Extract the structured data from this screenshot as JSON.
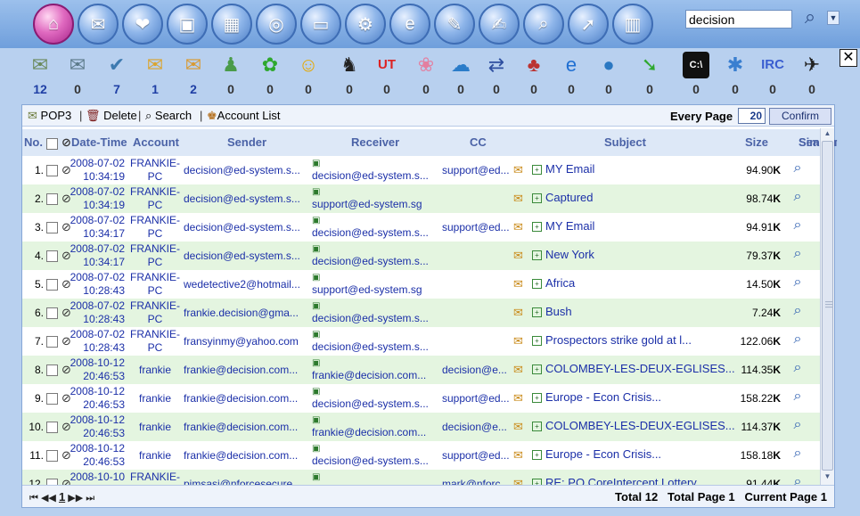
{
  "search": {
    "value": "decision"
  },
  "modules": [
    {
      "icon": "computer-icon",
      "glyph": "⌂"
    },
    {
      "icon": "envelope-icon",
      "glyph": "✉"
    },
    {
      "icon": "lips-icon",
      "glyph": "❤"
    },
    {
      "icon": "window-icon",
      "glyph": "▣"
    },
    {
      "icon": "box-icon",
      "glyph": "▦"
    },
    {
      "icon": "globe-icon",
      "glyph": "◎"
    },
    {
      "icon": "terminal-icon",
      "glyph": "▭"
    },
    {
      "icon": "gear-icon",
      "glyph": "⚙"
    },
    {
      "icon": "browser-icon",
      "glyph": "e"
    },
    {
      "icon": "tools-icon",
      "glyph": "✎"
    },
    {
      "icon": "notepad-icon",
      "glyph": "✍"
    },
    {
      "icon": "magnifier-icon",
      "glyph": "⌕"
    },
    {
      "icon": "mail-send-icon",
      "glyph": "➚"
    },
    {
      "icon": "chart-icon",
      "glyph": "▥"
    }
  ],
  "sources": [
    {
      "icon": "pop3-inbox-icon",
      "glyph": "✉",
      "count": "12",
      "color": "#6b8a5c"
    },
    {
      "icon": "download-mail-icon",
      "glyph": "✉",
      "count": "0",
      "color": "#5c7a8a"
    },
    {
      "icon": "outlook-icon",
      "glyph": "✔",
      "count": "7",
      "color": "#3d7ab0"
    },
    {
      "icon": "envelope-icon",
      "glyph": "✉",
      "count": "1",
      "color": "#d9a532"
    },
    {
      "icon": "webmail-icon",
      "glyph": "✉",
      "count": "2",
      "color": "#d99a32"
    },
    {
      "icon": "msn-icon",
      "glyph": "♟",
      "count": "0",
      "color": "#4a9b4a"
    },
    {
      "icon": "icq-icon",
      "glyph": "✿",
      "count": "0",
      "color": "#2ea82e"
    },
    {
      "icon": "yahoo-icon",
      "glyph": "☺",
      "count": "0",
      "color": "#e6a800"
    },
    {
      "icon": "qq-icon",
      "glyph": "♞",
      "count": "0",
      "color": "#222"
    },
    {
      "icon": "ut-icon",
      "glyph": "UT",
      "count": "0",
      "color": "#d22"
    },
    {
      "icon": "skype-icon",
      "glyph": "❀",
      "count": "0",
      "color": "#e37fa0"
    },
    {
      "icon": "file-transfer-icon",
      "glyph": "☁",
      "count": "0",
      "color": "#2b7cc9"
    },
    {
      "icon": "network-icon",
      "glyph": "⇄",
      "count": "0",
      "color": "#2e4fa0"
    },
    {
      "icon": "chat-icon",
      "glyph": "♣",
      "count": "0",
      "color": "#b33"
    },
    {
      "icon": "ie-icon",
      "glyph": "e",
      "count": "0",
      "color": "#1f6fd2"
    },
    {
      "icon": "earth-icon",
      "glyph": "●",
      "count": "0",
      "color": "#2b78c2"
    },
    {
      "icon": "arrow-icon",
      "glyph": "➘",
      "count": "0",
      "color": "#2ea82e"
    },
    {
      "icon": "cmd-icon",
      "glyph": "C:\\",
      "count": "0",
      "color": "#111"
    },
    {
      "icon": "settings-icon",
      "glyph": "✱",
      "count": "0",
      "color": "#3a7fd0"
    },
    {
      "icon": "irc-icon",
      "glyph": "IRC",
      "count": "0",
      "color": "#3a5ed0"
    },
    {
      "icon": "camera-icon",
      "glyph": "✈",
      "count": "0",
      "color": "#222"
    }
  ],
  "toolbar": {
    "pop3": "POP3",
    "delete": "Delete",
    "search": "Search",
    "account_list": "Account List",
    "every_page_label": "Every Page",
    "every_page_value": "20",
    "confirm": "Confirm"
  },
  "columns": {
    "no": "No.",
    "datetime": "Date-Time",
    "account": "Account",
    "sender": "Sender",
    "receiver": "Receiver",
    "cc": "CC",
    "subject": "Subject",
    "size": "Size",
    "similar_1": "Similar",
    "similar_2": "Search"
  },
  "rows": [
    {
      "no": "1.",
      "date": "2008-07-02",
      "time": "10:34:19",
      "account": "FRANKIE-PC",
      "sender": "decision@ed-system.s...",
      "receiver": "decision@ed-system.s...",
      "cc": "support@ed...",
      "subject": "MY Email",
      "size": "94.90",
      "unit": "K"
    },
    {
      "no": "2.",
      "date": "2008-07-02",
      "time": "10:34:19",
      "account": "FRANKIE-PC",
      "sender": "decision@ed-system.s...",
      "receiver": "support@ed-system.sg",
      "cc": "",
      "subject": "Captured",
      "size": "98.74",
      "unit": "K"
    },
    {
      "no": "3.",
      "date": "2008-07-02",
      "time": "10:34:17",
      "account": "FRANKIE-PC",
      "sender": "decision@ed-system.s...",
      "receiver": "decision@ed-system.s...",
      "cc": "support@ed...",
      "subject": "MY Email",
      "size": "94.91",
      "unit": "K"
    },
    {
      "no": "4.",
      "date": "2008-07-02",
      "time": "10:34:17",
      "account": "FRANKIE-PC",
      "sender": "decision@ed-system.s...",
      "receiver": "decision@ed-system.s...",
      "cc": "",
      "subject": "New York",
      "size": "79.37",
      "unit": "K"
    },
    {
      "no": "5.",
      "date": "2008-07-02",
      "time": "10:28:43",
      "account": "FRANKIE-PC",
      "sender": "wedetective2@hotmail...",
      "receiver": "support@ed-system.sg",
      "cc": "",
      "subject": "Africa",
      "size": "14.50",
      "unit": "K"
    },
    {
      "no": "6.",
      "date": "2008-07-02",
      "time": "10:28:43",
      "account": "FRANKIE-PC",
      "sender": "frankie.decision@gma...",
      "receiver": "decision@ed-system.s...",
      "cc": "",
      "subject": "Bush",
      "size": "7.24",
      "unit": "K"
    },
    {
      "no": "7.",
      "date": "2008-07-02",
      "time": "10:28:43",
      "account": "FRANKIE-PC",
      "sender": "fransyinmy@yahoo.com",
      "receiver": "decision@ed-system.s...",
      "cc": "",
      "subject": "Prospectors strike gold at l...",
      "size": "122.06",
      "unit": "K"
    },
    {
      "no": "8.",
      "date": "2008-10-12",
      "time": "20:46:53",
      "account": "frankie",
      "sender": "frankie@decision.com...",
      "receiver": "frankie@decision.com...",
      "cc": "decision@e...",
      "subject": "COLOMBEY-LES-DEUX-EGLISES...",
      "size": "114.35",
      "unit": "K"
    },
    {
      "no": "9.",
      "date": "2008-10-12",
      "time": "20:46:53",
      "account": "frankie",
      "sender": "frankie@decision.com...",
      "receiver": "decision@ed-system.s...",
      "cc": "support@ed...",
      "subject": "Europe - Econ Crisis...",
      "size": "158.22",
      "unit": "K"
    },
    {
      "no": "10.",
      "date": "2008-10-12",
      "time": "20:46:53",
      "account": "frankie",
      "sender": "frankie@decision.com...",
      "receiver": "frankie@decision.com...",
      "cc": "decision@e...",
      "subject": "COLOMBEY-LES-DEUX-EGLISES...",
      "size": "114.37",
      "unit": "K"
    },
    {
      "no": "11.",
      "date": "2008-10-12",
      "time": "20:46:53",
      "account": "frankie",
      "sender": "frankie@decision.com...",
      "receiver": "decision@ed-system.s...",
      "cc": "support@ed...",
      "subject": "Europe - Econ Crisis...",
      "size": "158.18",
      "unit": "K"
    },
    {
      "no": "12.",
      "date": "2008-10-10",
      "time": "",
      "account": "FRANKIE-PC",
      "sender": "pimsasi@nforcesecure...",
      "receiver": "frankie@decision.com...",
      "cc": "mark@nforc...",
      "subject": "RE: PO CoreIntercept Lottery...",
      "size": "91.44",
      "unit": "K"
    }
  ],
  "footer": {
    "page": "1",
    "total": "Total 12",
    "total_page": "Total Page 1",
    "current_page": "Current Page 1"
  }
}
